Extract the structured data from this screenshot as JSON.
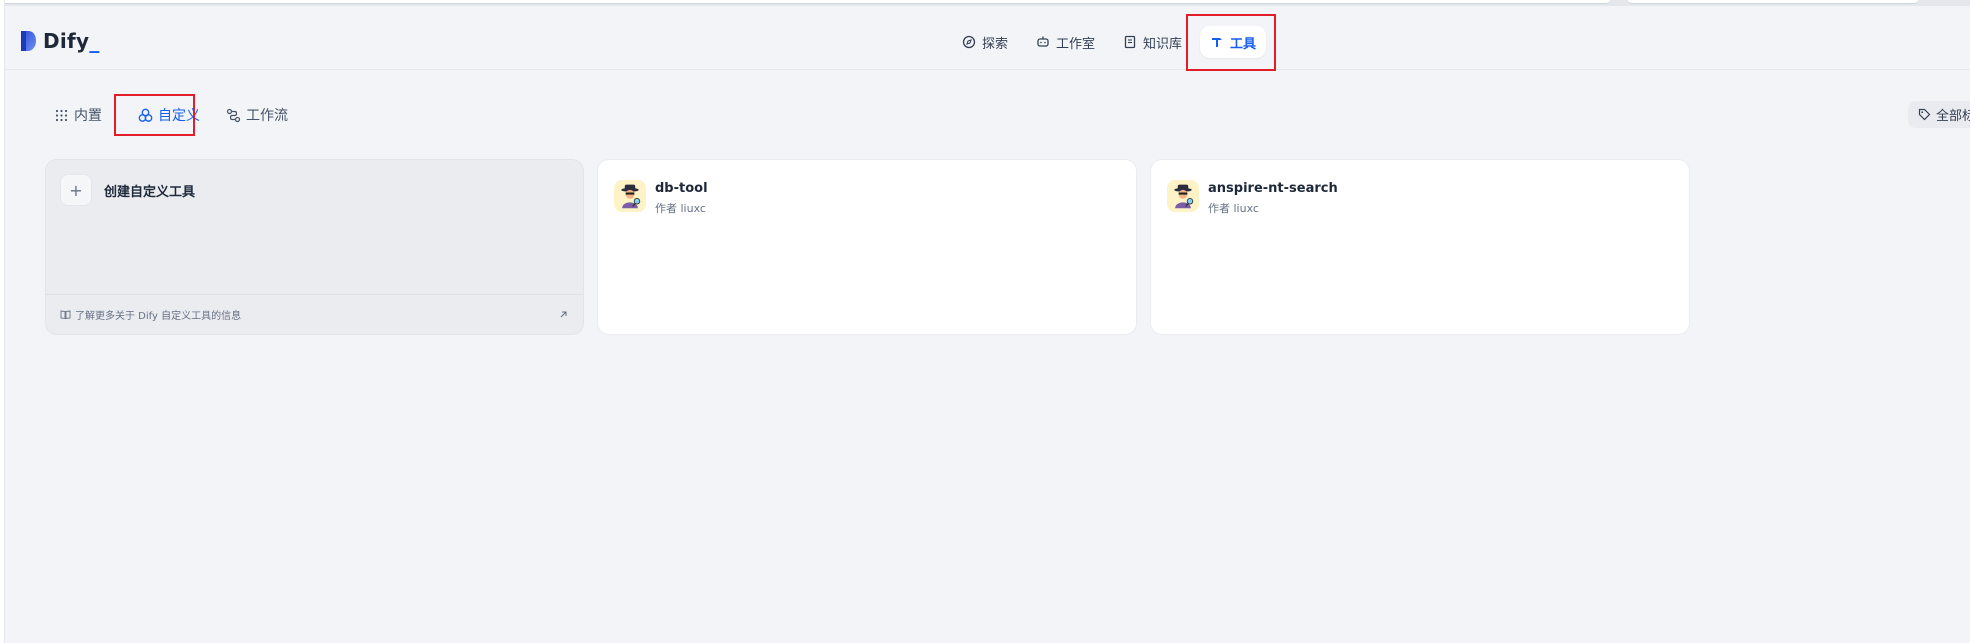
{
  "app": {
    "logo_text": "Dify",
    "logo_dot": "_"
  },
  "nav": {
    "items": [
      {
        "label": "探索",
        "icon": "compass-icon",
        "active": false
      },
      {
        "label": "工作室",
        "icon": "robot-icon",
        "active": false
      },
      {
        "label": "知识库",
        "icon": "book-icon",
        "active": false
      },
      {
        "label": "工具",
        "icon": "hammer-icon",
        "active": true
      }
    ]
  },
  "tabs": [
    {
      "label": "内置",
      "icon": "grid-dots-icon",
      "active": false
    },
    {
      "label": "自定义",
      "icon": "circles-icon",
      "active": true
    },
    {
      "label": "工作流",
      "icon": "workflow-icon",
      "active": false
    }
  ],
  "tag_filter": {
    "label": "全部标",
    "icon": "tag-icon"
  },
  "create_card": {
    "title": "创建自定义工具",
    "footer_link": "了解更多关于 Dify 自定义工具的信息"
  },
  "tools": [
    {
      "name": "db-tool",
      "author": "作者 liuxc",
      "icon": "detective-avatar-icon"
    },
    {
      "name": "anspire-nt-search",
      "author": "作者 liuxc",
      "icon": "detective-avatar-icon"
    }
  ],
  "colors": {
    "accent": "#155eef",
    "highlight_box": "#e11d2a",
    "background": "#f2f4f7"
  }
}
